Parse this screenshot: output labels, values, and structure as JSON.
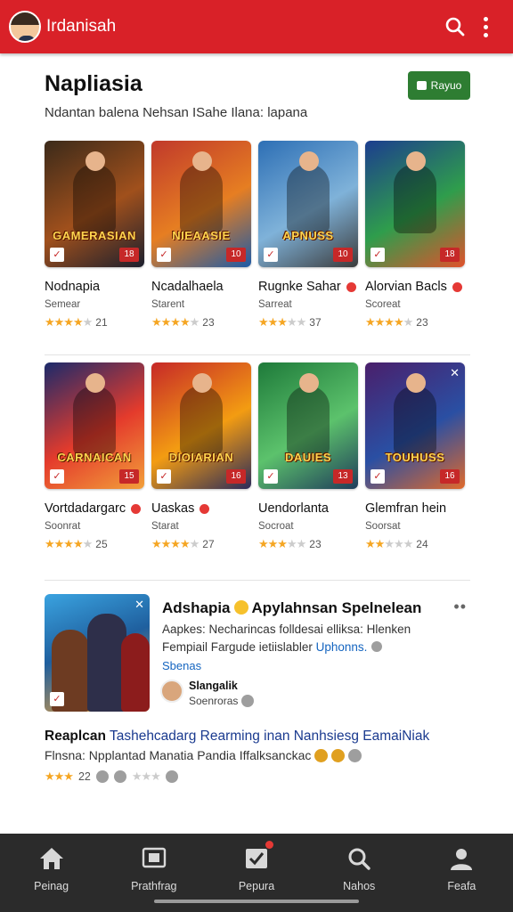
{
  "appbar": {
    "title": "Irdanisah",
    "color": "#d92128",
    "icons": [
      "avatar",
      "search-icon",
      "more-vert-icon"
    ]
  },
  "section": {
    "title": "Napliasia",
    "subtitle": "Ndantan balena Nehsan ISahe Ilana: lapana",
    "button_label": "Rayuo"
  },
  "row1": [
    {
      "name": "Nodnapia",
      "sub": "Semear",
      "stars": 4,
      "count": "21",
      "thumb_text": "GAMERASIAN",
      "badge": "18",
      "pin": false,
      "colors": [
        "#3b2a1a",
        "#a0501c",
        "#1b1f2e"
      ]
    },
    {
      "name": "Ncadalhaela",
      "sub": "Starent",
      "stars": 4,
      "count": "23",
      "thumb_text": "NIEAASIE",
      "badge": "10",
      "pin": false,
      "colors": [
        "#c0392b",
        "#e67e22",
        "#1c5aa6"
      ]
    },
    {
      "name": "Rugnke Sahar",
      "sub": "Sarreat",
      "stars": 3,
      "count": "37",
      "thumb_text": "APNUSS",
      "badge": "10",
      "pin": true,
      "colors": [
        "#2d6fb5",
        "#7fb2d9",
        "#3b3b3b"
      ]
    },
    {
      "name": "Alorvian Bacls",
      "sub": "Scoreat",
      "stars": 4,
      "count": "23",
      "thumb_text": "",
      "badge": "18",
      "pin": true,
      "colors": [
        "#1c3d8f",
        "#2f9d4c",
        "#e0522c"
      ]
    }
  ],
  "row2": [
    {
      "name": "Vortdadargarc",
      "sub": "Soonrat",
      "stars": 4,
      "count": "25",
      "thumb_text": "CARNAICAN",
      "badge": "15",
      "pin": true,
      "colors": [
        "#1b2a6b",
        "#e43b2c",
        "#f2a03a"
      ]
    },
    {
      "name": "Uaskas",
      "sub": "Starat",
      "stars": 4,
      "count": "27",
      "thumb_text": "DIOIARIAN",
      "badge": "16",
      "pin": true,
      "colors": [
        "#c62828",
        "#f39c12",
        "#2a2a5a"
      ]
    },
    {
      "name": "Uendorlanta",
      "sub": "Socroat",
      "stars": 3,
      "count": "23",
      "thumb_text": "DAUIES",
      "badge": "13",
      "pin": false,
      "colors": [
        "#1e7a3a",
        "#5cc26c",
        "#1f3b5a"
      ]
    },
    {
      "name": "Glemfran hein",
      "sub": "Soorsat",
      "stars": 2,
      "count": "24",
      "thumb_text": "TOUHUSS",
      "badge": "16",
      "pin": false,
      "colors": [
        "#4a1f6b",
        "#2a4fa3",
        "#e06a2c"
      ]
    }
  ],
  "feature": {
    "title_a": "Adshapia",
    "title_b": "Apylahnsan Spelnelean",
    "desc1": "Aapkes:  Necharincas folldesai elliksa: Hlenken",
    "desc2": "Fempiail Fargude ietiislabler",
    "desc2_link": "Uphonns.",
    "link": "Sbenas",
    "author": "Slangalik",
    "author_role": "Soenroras",
    "more": "••"
  },
  "headline": {
    "bold": "Reaplcan",
    "rest": "Tashehcadarg Rearming inan Nanhsiesg EamaiNiak",
    "desc": "Flnsna:  Npplantad Manatia Pandia Iffalksanckac",
    "count": "22",
    "stars": 3
  },
  "nav": [
    {
      "label": "Peinag",
      "icon": "home-icon"
    },
    {
      "label": "Prathfrag",
      "icon": "media-icon"
    },
    {
      "label": "Pepura",
      "icon": "checkbox-icon"
    },
    {
      "label": "Nahos",
      "icon": "search-icon"
    },
    {
      "label": "Feafa",
      "icon": "person-icon"
    }
  ]
}
